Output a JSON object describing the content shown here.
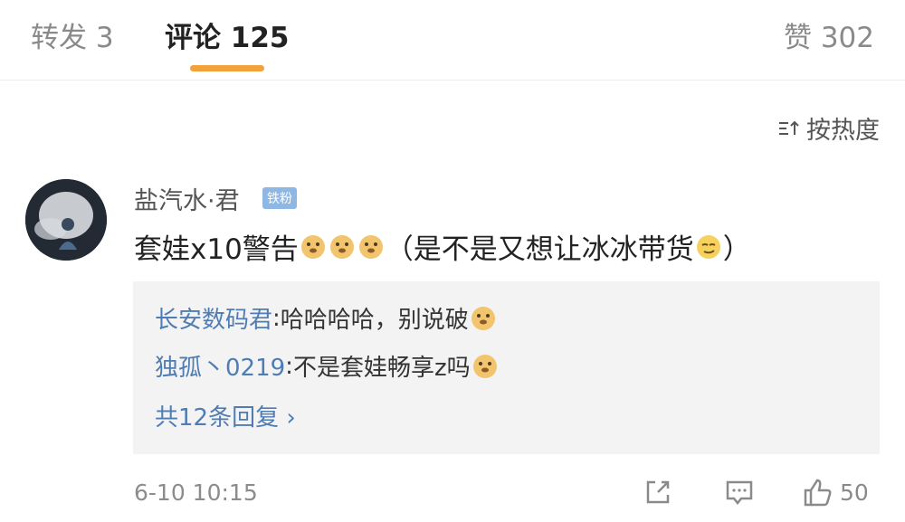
{
  "tabs": {
    "repost": "转发 3",
    "comment": "评论 125",
    "like": "赞 302"
  },
  "sort": {
    "label": "按热度",
    "icon": "sort-icon"
  },
  "comment": {
    "username": "盐汽水·君",
    "badge": "铁粉",
    "text_before": "套娃x10警告",
    "text_after": "（是不是又想让冰冰带货",
    "text_end": "）",
    "timestamp": "6-10 10:15",
    "like_count": "50"
  },
  "replies": [
    {
      "name": "长安数码君",
      "sep": ": ",
      "text": "哈哈哈哈，别说破"
    },
    {
      "name": "独孤丶0219",
      "sep": ": ",
      "text": "不是套娃畅享z吗"
    }
  ],
  "more_replies": "共12条回复 ›",
  "colors": {
    "accent": "#f2a13b",
    "link": "#4f7db3",
    "badge": "#8fb7e3"
  }
}
